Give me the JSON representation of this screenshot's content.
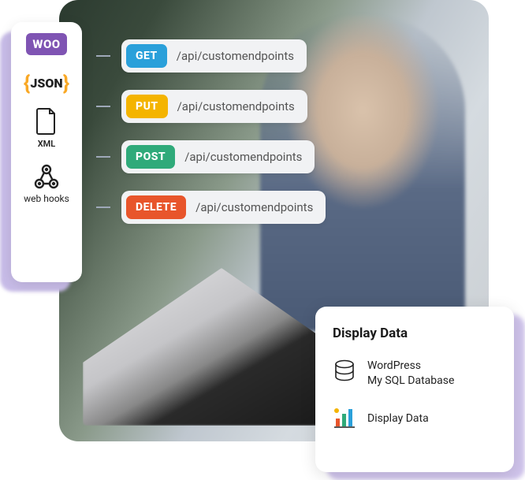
{
  "sidebar": {
    "items": [
      {
        "label": "WOO"
      },
      {
        "label": "JSON"
      },
      {
        "label": "XML"
      },
      {
        "label": "web hooks"
      }
    ]
  },
  "endpoints": [
    {
      "method": "GET",
      "color": "#2aa0da",
      "path": "/api/customendpoints"
    },
    {
      "method": "PUT",
      "color": "#f4b400",
      "path": "/api/customendpoints"
    },
    {
      "method": "POST",
      "color": "#2faa7a",
      "path": "/api/customendpoints"
    },
    {
      "method": "DELETE",
      "color": "#e8552b",
      "path": "/api/customendpoints"
    }
  ],
  "display_card": {
    "title": "Display Data",
    "rows": [
      {
        "line1": "WordPress",
        "line2": "My SQL Database"
      },
      {
        "line1": "Display Data",
        "line2": ""
      }
    ]
  }
}
